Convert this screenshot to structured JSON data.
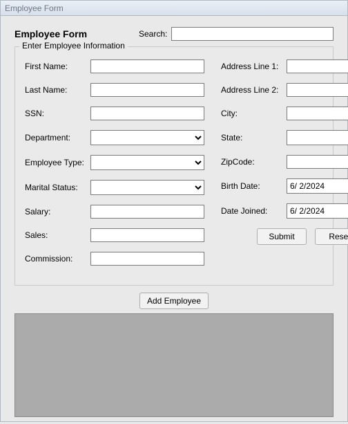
{
  "window": {
    "title": "Employee Form"
  },
  "header": {
    "form_title": "Employee Form",
    "search_label": "Search:",
    "search_value": ""
  },
  "groupbox": {
    "legend": "Enter Employee Information"
  },
  "left_fields": {
    "first_name": {
      "label": "First Name:",
      "value": ""
    },
    "last_name": {
      "label": "Last Name:",
      "value": ""
    },
    "ssn": {
      "label": "SSN:",
      "value": ""
    },
    "department": {
      "label": "Department:",
      "value": ""
    },
    "employee_type": {
      "label": "Employee Type:",
      "value": ""
    },
    "marital_status": {
      "label": "Marital Status:",
      "value": ""
    },
    "salary": {
      "label": "Salary:",
      "value": ""
    },
    "sales": {
      "label": "Sales:",
      "value": ""
    },
    "commission": {
      "label": "Commission:",
      "value": ""
    }
  },
  "right_fields": {
    "address1": {
      "label": "Address Line 1:",
      "value": ""
    },
    "address2": {
      "label": "Address Line 2:",
      "value": ""
    },
    "city": {
      "label": "City:",
      "value": ""
    },
    "state": {
      "label": "State:",
      "value": ""
    },
    "zipcode": {
      "label": "ZipCode:",
      "value": ""
    },
    "birth_date": {
      "label": "Birth Date:",
      "value": "6/  2/2024"
    },
    "date_joined": {
      "label": "Date Joined:",
      "value": "6/  2/2024"
    }
  },
  "buttons": {
    "submit": "Submit",
    "reset": "Reset",
    "add_employee": "Add Employee"
  }
}
